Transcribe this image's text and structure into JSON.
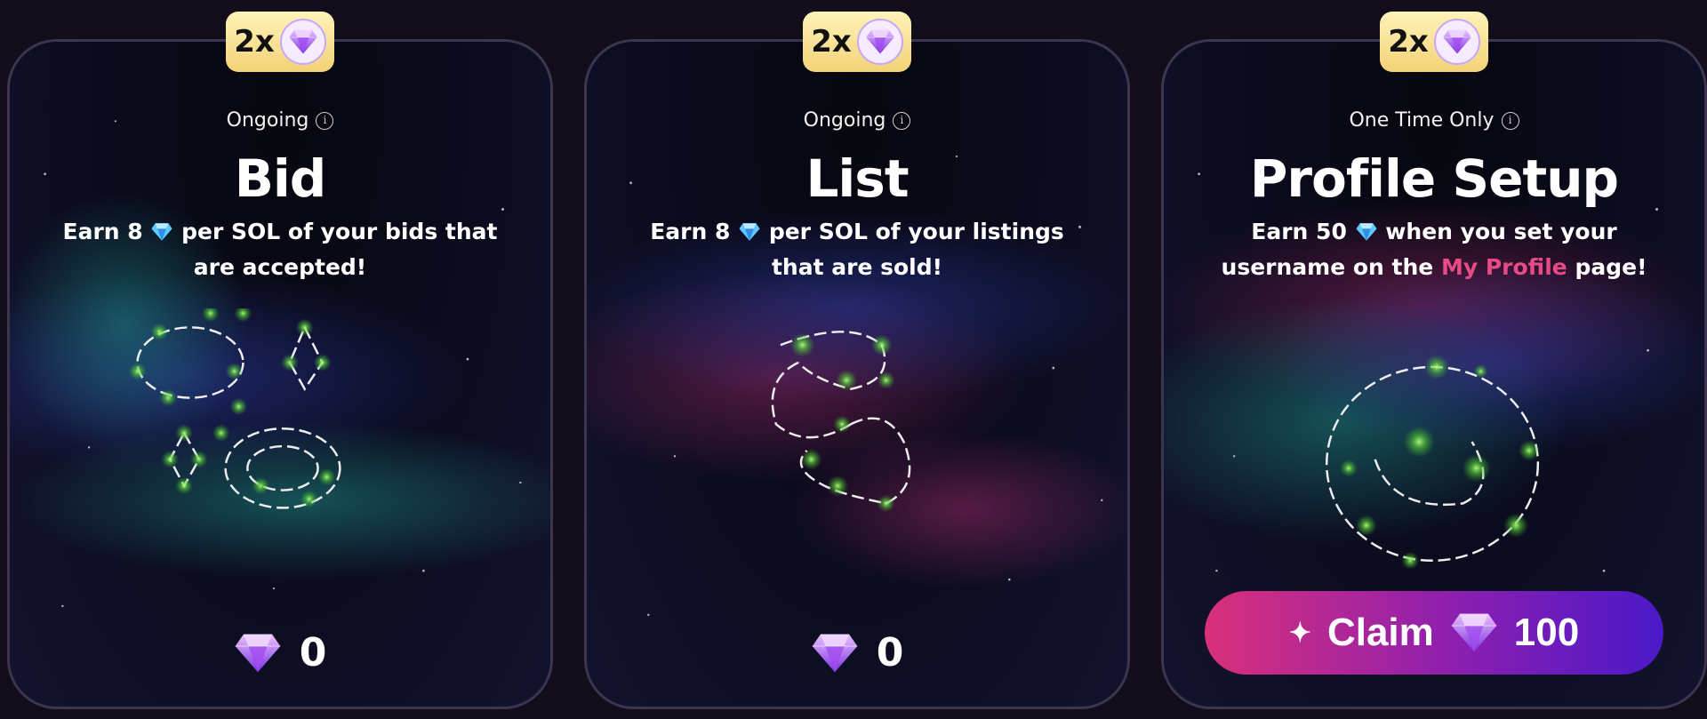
{
  "cards": [
    {
      "badge": "2x",
      "status": "Ongoing",
      "title": "Bid",
      "desc_line1_pre": "Earn 8",
      "desc_line1_post": "per SOL of your bids that",
      "desc_line2": "are accepted!",
      "count": "0"
    },
    {
      "badge": "2x",
      "status": "Ongoing",
      "title": "List",
      "desc_line1_pre": "Earn 8",
      "desc_line1_post": "per SOL of your listings",
      "desc_line2": "that are sold!",
      "count": "0"
    },
    {
      "badge": "2x",
      "status": "One Time Only",
      "title": "Profile Setup",
      "desc_line1_pre": "Earn 50",
      "desc_line1_post": "when you set your",
      "desc_line2_pre": "username on the",
      "desc_line2_link": "My Profile",
      "desc_line2_post": "page!",
      "claim_label": "Claim",
      "claim_amount": "100"
    }
  ],
  "icons": {
    "gem": "gem-icon",
    "info": "info-icon",
    "sparkle": "sparkle-icon"
  },
  "colors": {
    "badge": "#f3d277",
    "link": "#e64b86",
    "claim_start": "#d9307a",
    "claim_end": "#4a19c8",
    "constellation": "#7ddc4a"
  }
}
